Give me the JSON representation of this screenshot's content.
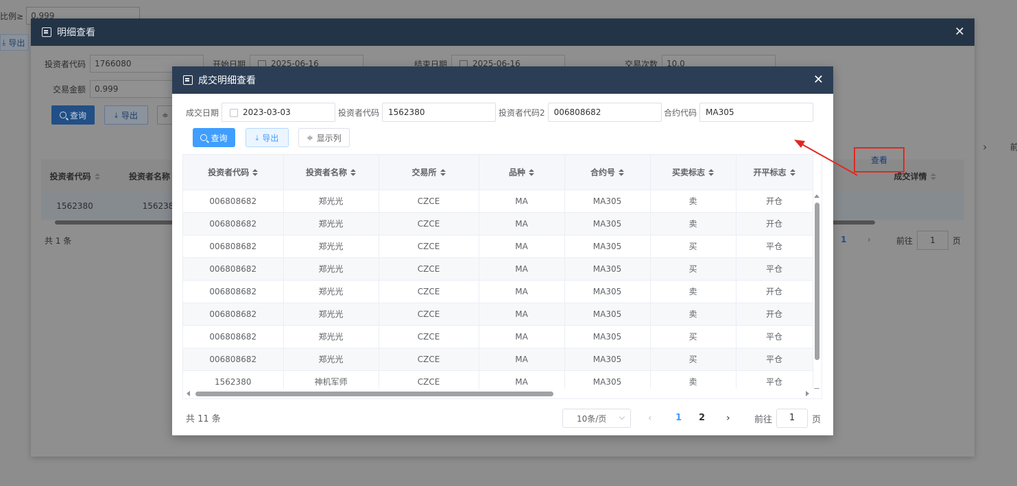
{
  "base": {
    "ratio_label": "比例≥",
    "ratio_value": "0.999",
    "export_label": "导出"
  },
  "dialog1": {
    "title": "明细查看",
    "fields": {
      "investor_code_label": "投资者代码",
      "investor_code_value": "1766080",
      "start_date_label": "开始日期",
      "start_date_value": "2025-06-16",
      "end_date_label": "结束日期",
      "end_date_value": "2025-06-16",
      "trade_count_label": "交易次数",
      "trade_count_value": "10.0",
      "trade_amount_label": "交易金额",
      "trade_amount_value": "0.999"
    },
    "buttons": {
      "query": "查询",
      "export": "导出"
    },
    "table": {
      "headers": [
        "投资者代码",
        "投资者名称",
        "成交详情"
      ],
      "row": [
        "1562380",
        "156238"
      ],
      "view_label": "查看"
    },
    "pager": {
      "total": "共 1 条",
      "page": "1",
      "goto_prefix": "前往",
      "goto_value": "1",
      "goto_suffix": "页",
      "extra": "前"
    }
  },
  "dialog2": {
    "title": "成交明细查看",
    "fields": {
      "trade_date_label": "成交日期",
      "trade_date_value": "2023-03-03",
      "investor_code_label": "投资者代码",
      "investor_code_value": "1562380",
      "investor_code2_label": "投资者代码2",
      "investor_code2_value": "006808682",
      "contract_label": "合约代码",
      "contract_value": "MA305"
    },
    "buttons": {
      "query": "查询",
      "export": "导出",
      "columns": "显示列"
    },
    "table": {
      "headers": [
        "投资者代码",
        "投资者名称",
        "交易所",
        "品种",
        "合约号",
        "买卖标志",
        "开平标志"
      ],
      "rows": [
        [
          "006808682",
          "郑光光",
          "CZCE",
          "MA",
          "MA305",
          "卖",
          "开仓"
        ],
        [
          "006808682",
          "郑光光",
          "CZCE",
          "MA",
          "MA305",
          "卖",
          "开仓"
        ],
        [
          "006808682",
          "郑光光",
          "CZCE",
          "MA",
          "MA305",
          "买",
          "平仓"
        ],
        [
          "006808682",
          "郑光光",
          "CZCE",
          "MA",
          "MA305",
          "买",
          "平仓"
        ],
        [
          "006808682",
          "郑光光",
          "CZCE",
          "MA",
          "MA305",
          "卖",
          "开仓"
        ],
        [
          "006808682",
          "郑光光",
          "CZCE",
          "MA",
          "MA305",
          "卖",
          "开仓"
        ],
        [
          "006808682",
          "郑光光",
          "CZCE",
          "MA",
          "MA305",
          "买",
          "平仓"
        ],
        [
          "006808682",
          "郑光光",
          "CZCE",
          "MA",
          "MA305",
          "买",
          "平仓"
        ],
        [
          "1562380",
          "神机军师",
          "CZCE",
          "MA",
          "MA305",
          "卖",
          "平仓"
        ]
      ]
    },
    "pager": {
      "total": "共 11 条",
      "page_size": "10条/页",
      "pages": [
        "1",
        "2"
      ],
      "current_page": "1",
      "goto_prefix": "前往",
      "goto_value": "1",
      "goto_suffix": "页"
    }
  },
  "colors": {
    "primary": "#409eff",
    "header_dark": "#2c3e55",
    "annotation_red": "#e0281f"
  }
}
